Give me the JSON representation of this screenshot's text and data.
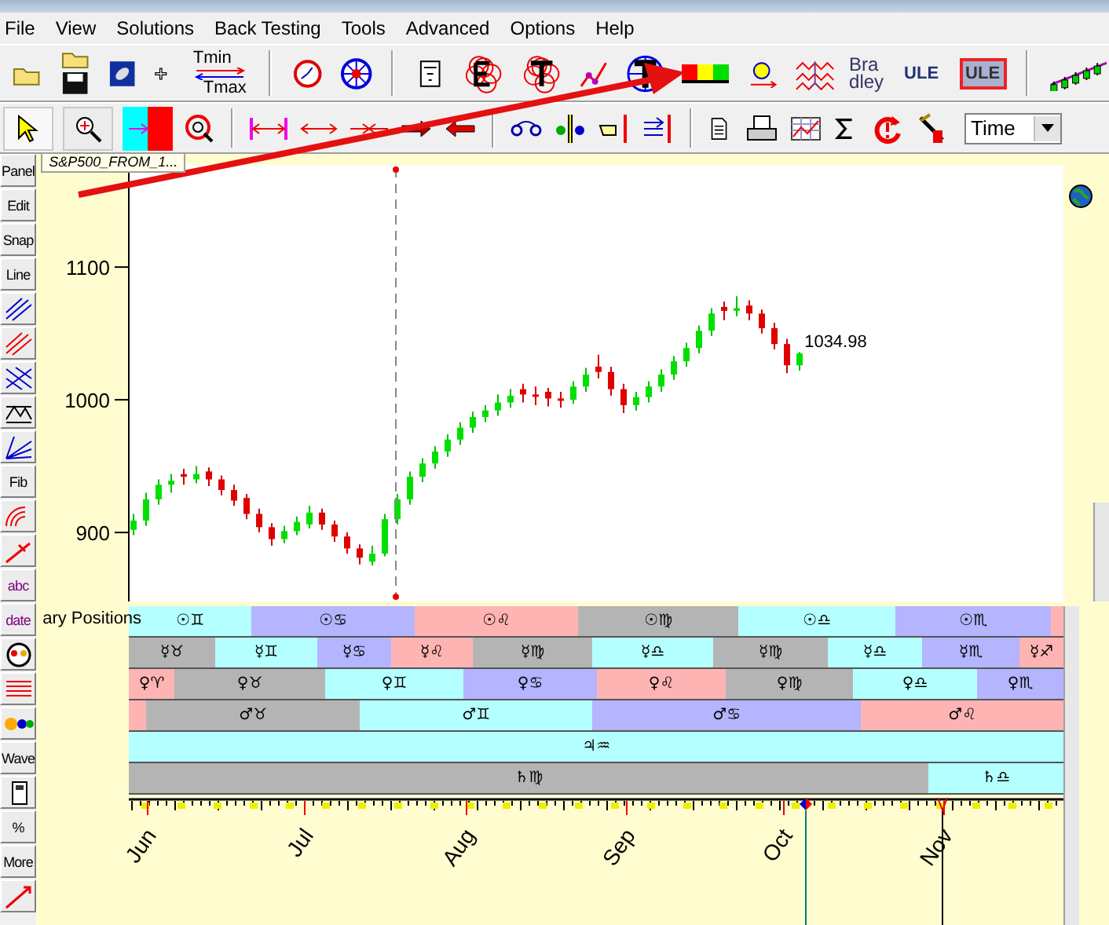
{
  "menu": [
    "File",
    "View",
    "Solutions",
    "Back Testing",
    "Tools",
    "Advanced",
    "Options",
    "Help"
  ],
  "toolbar_top": {
    "tmin": "Tmin",
    "tmax": "Tmax",
    "bradley": [
      "Bra",
      "dley"
    ],
    "ule_buttons": [
      {
        "label": "ULE",
        "selected": false
      },
      {
        "label": "ULE",
        "selected": true
      }
    ]
  },
  "toolbar_drawing": {
    "time_select": {
      "value": "Time"
    }
  },
  "left_toolbar": [
    "Panel",
    "Edit",
    "Snap",
    "Line",
    "Fib",
    "abc",
    "date",
    "Wave",
    "%",
    "More"
  ],
  "chart": {
    "tab": "S&P500_FROM_1...",
    "last_price": "1034.98",
    "months": [
      "Jun",
      "Jul",
      "Aug",
      "Sep",
      "Oct",
      "Nov"
    ],
    "chart_data": {
      "type": "candlestick",
      "yticks": [
        900,
        1000,
        1100
      ],
      "ylim": [
        848,
        1177
      ],
      "ohlc": [
        [
          902,
          914,
          898,
          909
        ],
        [
          909,
          930,
          905,
          925
        ],
        [
          925,
          940,
          921,
          936
        ],
        [
          936,
          944,
          930,
          939
        ],
        [
          944,
          948,
          936,
          942
        ],
        [
          940,
          950,
          937,
          944
        ],
        [
          946,
          949,
          935,
          940
        ],
        [
          940,
          943,
          928,
          932
        ],
        [
          932,
          936,
          920,
          924
        ],
        [
          926,
          929,
          910,
          914
        ],
        [
          914,
          918,
          900,
          904
        ],
        [
          904,
          907,
          890,
          895
        ],
        [
          895,
          905,
          892,
          901
        ],
        [
          901,
          912,
          898,
          908
        ],
        [
          906,
          920,
          903,
          915
        ],
        [
          915,
          918,
          902,
          906
        ],
        [
          906,
          909,
          893,
          897
        ],
        [
          897,
          900,
          884,
          888
        ],
        [
          888,
          891,
          876,
          881
        ],
        [
          878,
          890,
          875,
          884
        ],
        [
          884,
          914,
          882,
          910
        ],
        [
          910,
          929,
          906,
          925
        ],
        [
          925,
          946,
          921,
          942
        ],
        [
          942,
          956,
          938,
          952
        ],
        [
          952,
          965,
          948,
          961
        ],
        [
          961,
          974,
          957,
          970
        ],
        [
          970,
          983,
          966,
          979
        ],
        [
          979,
          991,
          975,
          987
        ],
        [
          987,
          996,
          983,
          992
        ],
        [
          992,
          1004,
          988,
          998
        ],
        [
          998,
          1008,
          994,
          1003
        ],
        [
          1008,
          1012,
          998,
          1004
        ],
        [
          1004,
          1010,
          996,
          1003
        ],
        [
          1006,
          1009,
          995,
          1001
        ],
        [
          1001,
          1006,
          994,
          1000
        ],
        [
          1000,
          1014,
          997,
          1010
        ],
        [
          1010,
          1024,
          1006,
          1019
        ],
        [
          1025,
          1034,
          1016,
          1021
        ],
        [
          1021,
          1025,
          1003,
          1008
        ],
        [
          1008,
          1012,
          990,
          996
        ],
        [
          996,
          1006,
          992,
          1002
        ],
        [
          1002,
          1014,
          998,
          1010
        ],
        [
          1010,
          1023,
          1006,
          1019
        ],
        [
          1019,
          1033,
          1015,
          1029
        ],
        [
          1029,
          1043,
          1025,
          1039
        ],
        [
          1039,
          1056,
          1035,
          1052
        ],
        [
          1052,
          1069,
          1048,
          1065
        ],
        [
          1070,
          1074,
          1060,
          1067
        ],
        [
          1067,
          1078,
          1063,
          1069
        ],
        [
          1071,
          1075,
          1060,
          1065
        ],
        [
          1065,
          1068,
          1050,
          1054
        ],
        [
          1054,
          1058,
          1038,
          1042
        ],
        [
          1042,
          1046,
          1020,
          1026
        ],
        [
          1026,
          1036,
          1022,
          1035
        ]
      ]
    }
  },
  "planetary": {
    "label": "ary Positions",
    "rows": [
      {
        "segments": [
          {
            "label": "☉♊",
            "color": "#b4ffff"
          },
          {
            "label": "☉♋",
            "color": "#b4b4ff"
          },
          {
            "label": "☉♌",
            "color": "#ffb4b4"
          },
          {
            "label": "☉♍",
            "color": "#b4b4b4"
          },
          {
            "label": "☉♎",
            "color": "#b4ffff"
          },
          {
            "label": "☉♏",
            "color": "#b4b4ff"
          },
          {
            "color": "#ffb4b4"
          }
        ]
      },
      {
        "segments": [
          {
            "label": "☿♉",
            "color": "#b4b4b4"
          },
          {
            "label": "☿♊",
            "color": "#b4ffff"
          },
          {
            "label": "☿♋",
            "color": "#b4b4ff"
          },
          {
            "label": "☿♌",
            "color": "#ffb4b4"
          },
          {
            "label": "☿♍",
            "color": "#b4b4b4"
          },
          {
            "label": "☿♎",
            "color": "#b4ffff"
          },
          {
            "label": "☿♍",
            "color": "#b4b4b4"
          },
          {
            "label": "☿♎",
            "color": "#b4ffff"
          },
          {
            "label": "☿♏",
            "color": "#b4b4ff"
          },
          {
            "label": "☿♐",
            "color": "#ffb4b4"
          }
        ]
      },
      {
        "segments": [
          {
            "label": "♀♈",
            "color": "#ffb4b4"
          },
          {
            "label": "♀♉",
            "color": "#b4b4b4"
          },
          {
            "label": "♀♊",
            "color": "#b4ffff"
          },
          {
            "label": "♀♋",
            "color": "#b4b4ff"
          },
          {
            "label": "♀♌",
            "color": "#ffb4b4"
          },
          {
            "label": "♀♍",
            "color": "#b4b4b4"
          },
          {
            "label": "♀♎",
            "color": "#b4ffff"
          },
          {
            "label": "♀♏",
            "color": "#b4b4ff"
          }
        ]
      },
      {
        "segments": [
          {
            "color": "#ffb4b4"
          },
          {
            "label": "♂♉",
            "color": "#b4b4b4"
          },
          {
            "label": "♂♊",
            "color": "#b4ffff"
          },
          {
            "label": "♂♋",
            "color": "#b4b4ff"
          },
          {
            "label": "♂♌",
            "color": "#ffb4b4"
          }
        ]
      },
      {
        "segments": [
          {
            "label": "♃♒",
            "color": "#b4ffff"
          }
        ]
      },
      {
        "segments": [
          {
            "label": "♄♍",
            "color": "#b4b4b4"
          },
          {
            "label": "♄♎",
            "color": "#b4ffff"
          }
        ]
      }
    ]
  }
}
